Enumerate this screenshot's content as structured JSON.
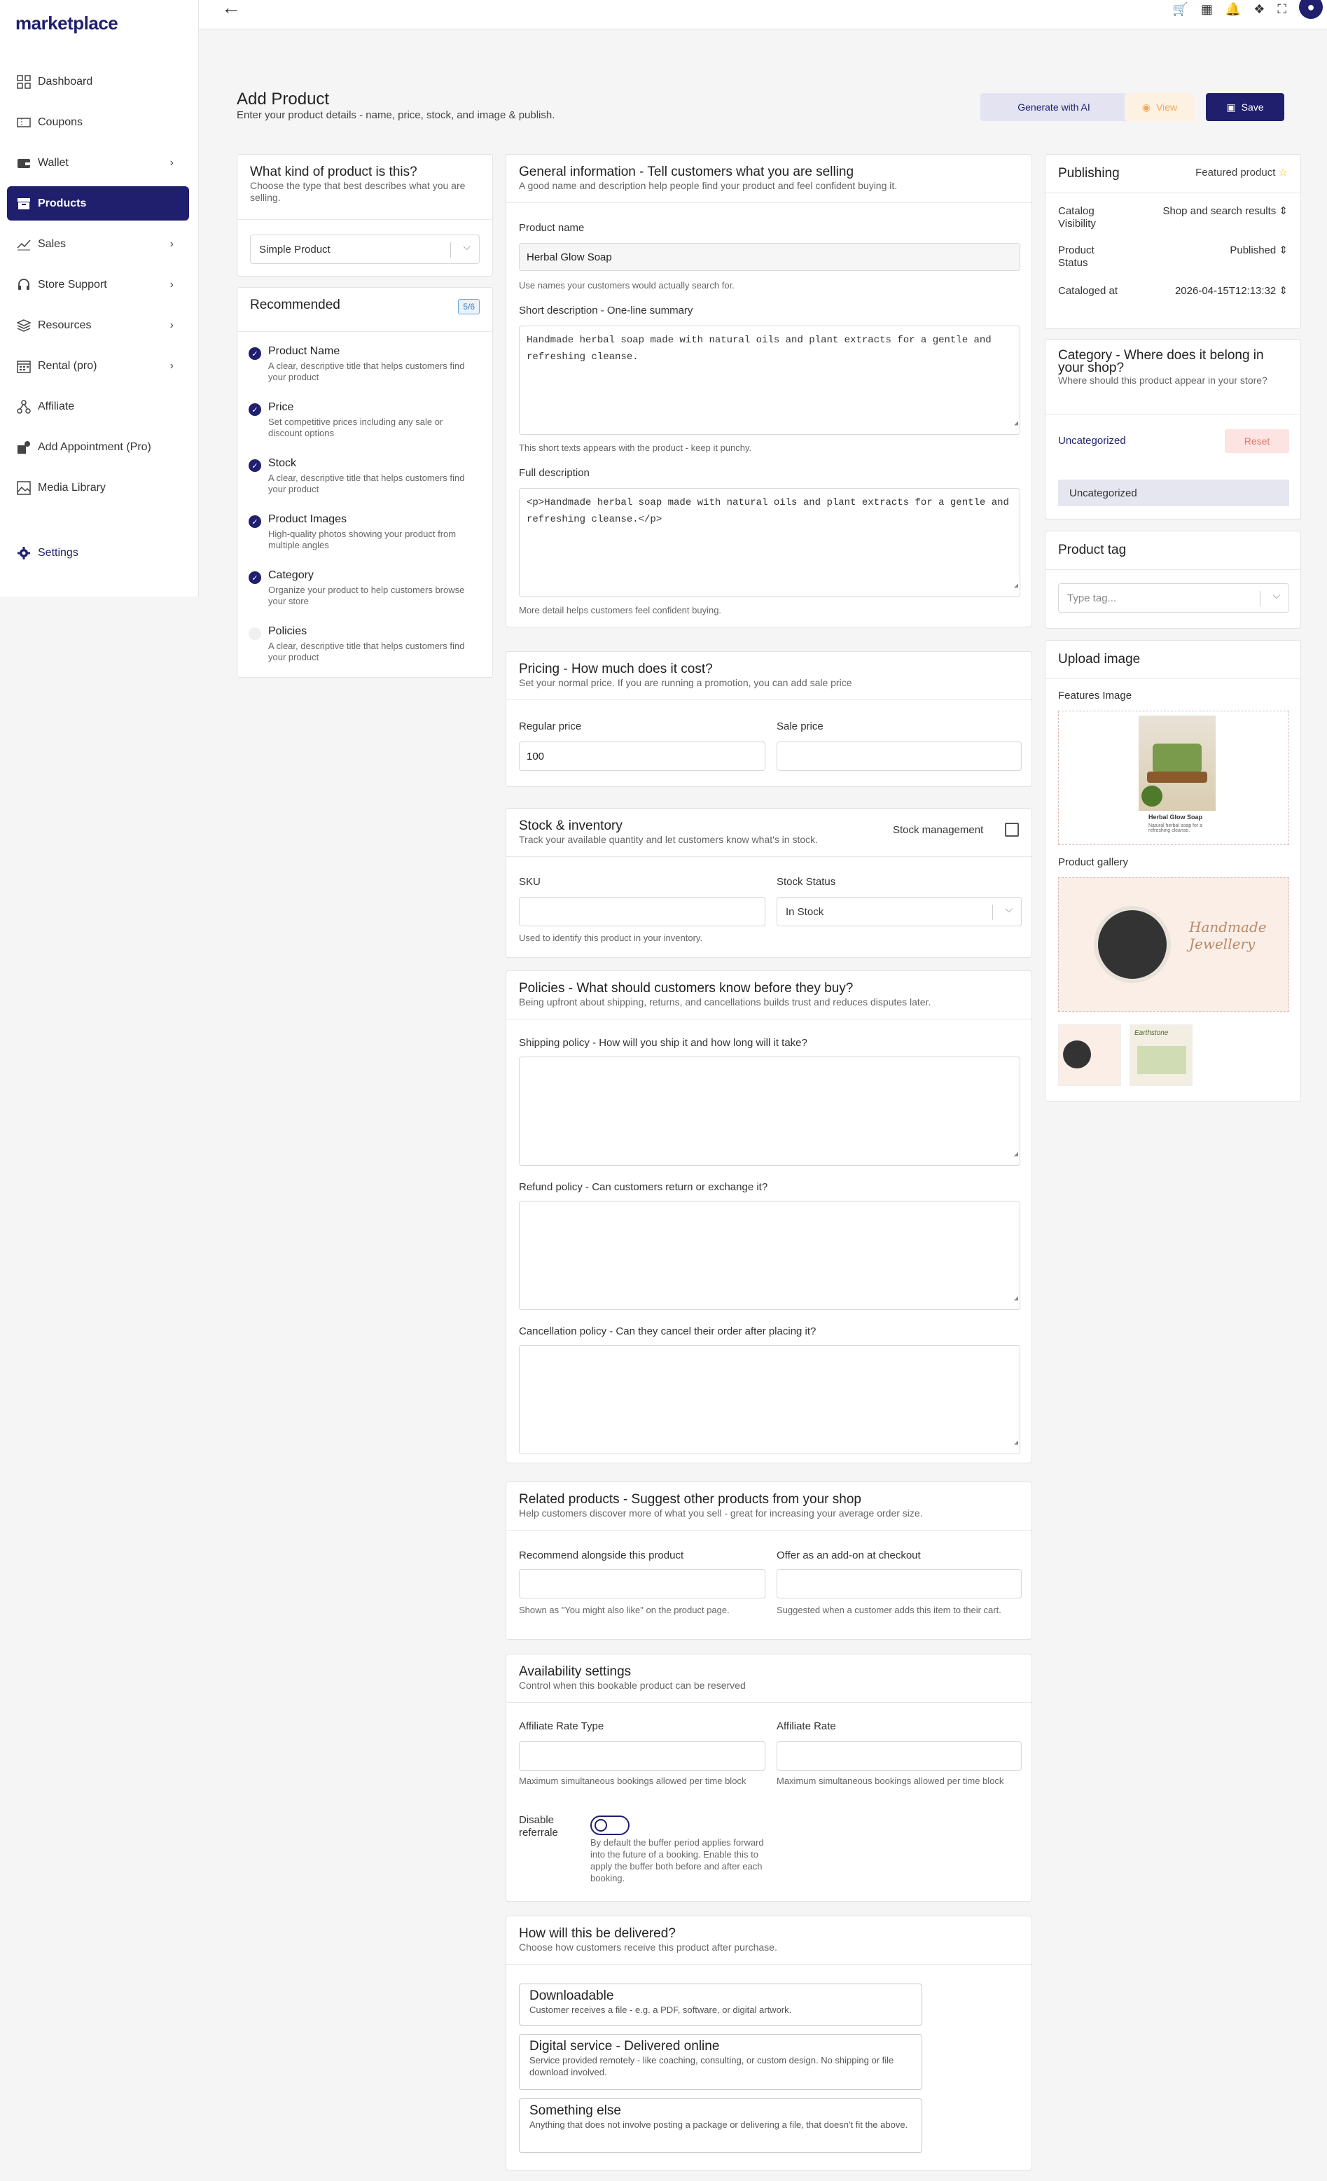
{
  "app": {
    "logo": "marketplace"
  },
  "sidebar": {
    "items": [
      {
        "label": "Dashboard",
        "icon": "dashboard-icon",
        "chevron": false
      },
      {
        "label": "Coupons",
        "icon": "coupon-icon",
        "chevron": false
      },
      {
        "label": "Wallet",
        "icon": "wallet-icon",
        "chevron": true
      },
      {
        "label": "Products",
        "icon": "products-icon",
        "chevron": false,
        "active": true
      },
      {
        "label": "Sales",
        "icon": "sales-icon",
        "chevron": true
      },
      {
        "label": "Store Support",
        "icon": "headset-icon",
        "chevron": true
      },
      {
        "label": "Resources",
        "icon": "layers-icon",
        "chevron": true
      },
      {
        "label": "Rental (pro)",
        "icon": "calendar-icon",
        "chevron": true
      },
      {
        "label": "Affiliate",
        "icon": "affiliate-icon",
        "chevron": false
      },
      {
        "label": "Add Appointment (Pro)",
        "icon": "appointment-icon",
        "chevron": false
      },
      {
        "label": "Media Library",
        "icon": "image-icon",
        "chevron": false
      }
    ],
    "settings_label": "Settings"
  },
  "header": {
    "title": "Add Product",
    "subtitle": "Enter your product details - name, price, stock, and image & publish.",
    "ai_button": "Generate with AI",
    "view_button": "View",
    "save_button": "Save"
  },
  "product_type": {
    "title": "What kind of product is this?",
    "desc": "Choose the type that best describes what you are selling.",
    "selected": "Simple Product"
  },
  "recommended": {
    "title": "Recommended",
    "badge": "5/6",
    "items": [
      {
        "title": "Product Name",
        "desc": "A clear, descriptive title that helps customers find your product",
        "done": true
      },
      {
        "title": "Price",
        "desc": "Set competitive prices including any sale or discount options",
        "done": true
      },
      {
        "title": "Stock",
        "desc": "A clear, descriptive title that helps customers find your product",
        "done": true
      },
      {
        "title": "Product Images",
        "desc": "High-quality photos showing your product from multiple angles",
        "done": true
      },
      {
        "title": "Category",
        "desc": "Organize your product to help customers browse your store",
        "done": true
      },
      {
        "title": "Policies",
        "desc": "A clear, descriptive title that helps customers find your product",
        "done": false
      }
    ]
  },
  "general": {
    "title": "General information - Tell customers what you are selling",
    "desc": "A good name and description help people find your product and feel confident buying it.",
    "name_label": "Product name",
    "name_value": "Herbal Glow Soap",
    "name_hint": "Use names your customers would actually search for.",
    "short_label": "Short description - One-line summary",
    "short_value": "Handmade herbal soap made with natural oils and plant extracts for a gentle and refreshing cleanse.",
    "short_hint": "This short texts appears with the product - keep it punchy.",
    "full_label": "Full description",
    "full_value": "<p>Handmade herbal soap made with natural oils and plant extracts for a gentle and refreshing cleanse.</p>",
    "full_hint": "More detail helps customers feel confident buying."
  },
  "pricing": {
    "title": "Pricing - How much does it cost?",
    "desc": "Set your normal price. If you are running a promotion, you can add sale price",
    "regular_label": "Regular price",
    "regular_value": "100",
    "sale_label": "Sale price",
    "sale_value": ""
  },
  "stock": {
    "title": "Stock & inventory",
    "desc": "Track your available quantity and let customers know what's in stock.",
    "management_label": "Stock management",
    "sku_label": "SKU",
    "sku_value": "",
    "sku_hint": "Used to identify this product in your inventory.",
    "status_label": "Stock Status",
    "status_value": "In Stock"
  },
  "policies": {
    "title": "Policies - What should customers know before they buy?",
    "desc": "Being upfront about shipping, returns, and cancellations builds trust and reduces disputes later.",
    "shipping_label": "Shipping policy - How will you ship it and how long will it take?",
    "refund_label": "Refund policy - Can customers return or exchange it?",
    "cancel_label": "Cancellation policy - Can they cancel their order after placing it?"
  },
  "related": {
    "title": "Related products - Suggest other products from your shop",
    "desc": "Help customers discover more of what you sell - great for increasing your average order size.",
    "recommend_label": "Recommend alongside this product",
    "recommend_hint": "Shown as \"You might also like\" on the product page.",
    "addon_label": "Offer as an add-on at checkout",
    "addon_hint": "Suggested when a customer adds this item to their cart."
  },
  "availability": {
    "title": "Availability settings",
    "desc": "Control when this bookable product can be reserved",
    "rate_type_label": "Affiliate Rate Type",
    "rate_type_hint": "Maximum simultaneous bookings allowed per time block",
    "rate_label": "Affiliate Rate",
    "rate_hint": "Maximum simultaneous bookings allowed per time block",
    "referral_label": "Disable referrale",
    "referral_hint": "By default the buffer period applies forward into the future of a booking. Enable this to apply the buffer both before and after each booking."
  },
  "delivery": {
    "title": "How will this be delivered?",
    "desc": "Choose how customers receive this product after purchase.",
    "options": [
      {
        "title": "Downloadable",
        "desc": "Customer receives a file - e.g. a PDF, software, or digital artwork."
      },
      {
        "title": "Digital service - Delivered online",
        "desc": "Service provided remotely - like coaching, consulting, or custom design. No shipping or file download involved."
      },
      {
        "title": "Something else",
        "desc": "Anything that does not involve posting a package or delivering a file, that doesn't fit the above."
      }
    ]
  },
  "publishing": {
    "title": "Publishing",
    "featured_label": "Featured product",
    "visibility_label": "Catalog Visibility",
    "visibility_value": "Shop and search results",
    "status_label": "Product Status",
    "status_value": "Published",
    "cataloged_label": "Cataloged at",
    "cataloged_value": "2026-04-15T12:13:32"
  },
  "category": {
    "title": "Category - Where does it belong in your shop?",
    "desc": "Where should this product appear in your store?",
    "link": "Uncategorized",
    "reset": "Reset",
    "selected": "Uncategorized"
  },
  "tag": {
    "title": "Product tag",
    "placeholder": "Type tag..."
  },
  "upload": {
    "title": "Upload image",
    "features_label": "Features Image",
    "feature_caption": "Herbal Glow Soap",
    "feature_sub": "Natural herbal soap for a refreshing cleanse.",
    "gallery_label": "Product gallery",
    "gallery_text": "Handmade Jewellery",
    "thumb2_text": "Earthstone"
  },
  "colors": {
    "brand": "#1f1f6e",
    "view": "#f0a85a",
    "reset_bg": "#fde3e1",
    "reset_fg": "#e07a70"
  }
}
